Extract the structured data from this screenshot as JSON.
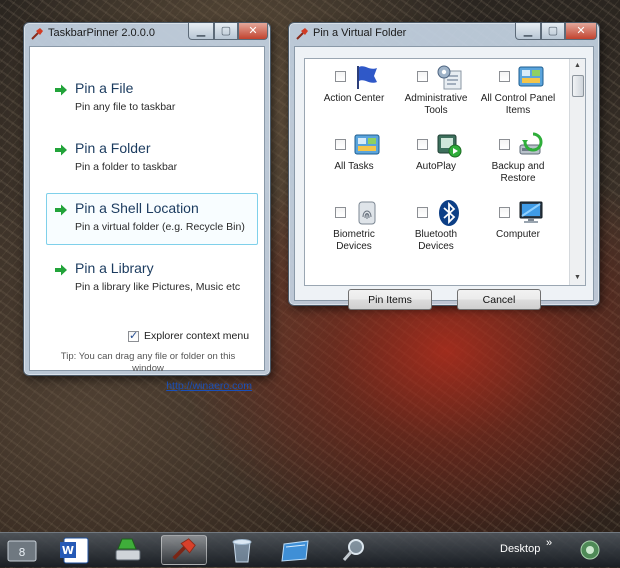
{
  "pinner_window": {
    "title": "TaskbarPinner 2.0.0.0",
    "actions": [
      {
        "title": "Pin a File",
        "desc": "Pin any file to taskbar"
      },
      {
        "title": "Pin a Folder",
        "desc": "Pin a folder to taskbar"
      },
      {
        "title": "Pin a Shell Location",
        "desc": "Pin a virtual folder (e.g. Recycle Bin)"
      },
      {
        "title": "Pin a Library",
        "desc": "Pin a library like Pictures, Music etc"
      }
    ],
    "explorer_context_menu": {
      "label": "Explorer context menu",
      "checked": true
    },
    "tip": "Tip: You can drag any file or folder on this window",
    "link": "http://winaero.com"
  },
  "virtual_folder_window": {
    "title": "Pin a Virtual Folder",
    "items": [
      {
        "label": "Action Center",
        "icon": "flag-icon"
      },
      {
        "label": "Administrative Tools",
        "icon": "admin-tools-icon"
      },
      {
        "label": "All Control Panel Items",
        "icon": "control-panel-icon"
      },
      {
        "label": "All Tasks",
        "icon": "control-panel-icon"
      },
      {
        "label": "AutoPlay",
        "icon": "autoplay-icon"
      },
      {
        "label": "Backup and Restore",
        "icon": "backup-icon"
      },
      {
        "label": "Biometric Devices",
        "icon": "fingerprint-icon"
      },
      {
        "label": "Bluetooth Devices",
        "icon": "bluetooth-icon"
      },
      {
        "label": "Computer",
        "icon": "computer-icon"
      }
    ],
    "pin_button": "Pin Items",
    "cancel_button": "Cancel"
  },
  "taskbar": {
    "items": [
      {
        "name": "start-app-icon"
      },
      {
        "name": "word-icon"
      },
      {
        "name": "drive-icon"
      },
      {
        "name": "taskbarpinner-icon",
        "active": true
      },
      {
        "name": "recycle-bin-icon"
      },
      {
        "name": "desktop-folder-icon"
      },
      {
        "name": "magnifier-icon"
      }
    ],
    "desktop_label": "Desktop",
    "desktop_chevron": "»"
  },
  "colors": {
    "link": "#1a4fb8",
    "action_title": "#1b3b5f",
    "arrow_green": "#22a33a",
    "highlight_border": "#7fd0ea"
  }
}
